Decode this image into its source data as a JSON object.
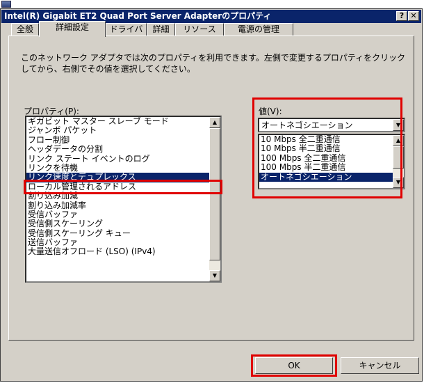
{
  "window": {
    "title": "Intel(R) Gigabit ET2 Quad Port Server Adapterのプロパティ",
    "help_btn": "?",
    "close_btn": "✕"
  },
  "tabs": [
    "全般",
    "詳細設定",
    "ドライバ",
    "詳細",
    "リソース",
    "電源の管理"
  ],
  "active_tab": "詳細設定",
  "description": "このネットワーク アダプタでは次のプロパティを利用できます。左側で変更するプロパティをクリックしてから、右側でその値を選択してください。",
  "properties": {
    "label": "プロパティ(P):",
    "items": [
      "ギガビット マスター スレーブ モード",
      "ジャンボ パケット",
      "フロー制御",
      "ヘッダデータの分割",
      "リンク ステート イベントのログ",
      "リンクを待機",
      "リンク速度とデュプレックス",
      "ローカル管理されるアドレス",
      "割り込み加減",
      "割り込み加減率",
      "受信バッファ",
      "受信側スケーリング",
      "受信側スケーリング キュー",
      "送信バッファ",
      "大量送信オフロード (LSO) (IPv4)"
    ],
    "selected": "リンク速度とデュプレックス"
  },
  "value": {
    "label": "値(V):",
    "current": "オートネゴシエーション",
    "options": [
      "10 Mbps 全二重通信",
      "10 Mbps 半二重通信",
      "100 Mbps 全二重通信",
      "100 Mbps 半二重通信",
      "オートネゴシエーション"
    ],
    "selected": "オートネゴシエーション"
  },
  "buttons": {
    "ok": "OK",
    "cancel": "キャンセル"
  },
  "colors": {
    "highlight": "#e00000",
    "selection": "#0a246a",
    "titlebar": "#0a246a"
  }
}
